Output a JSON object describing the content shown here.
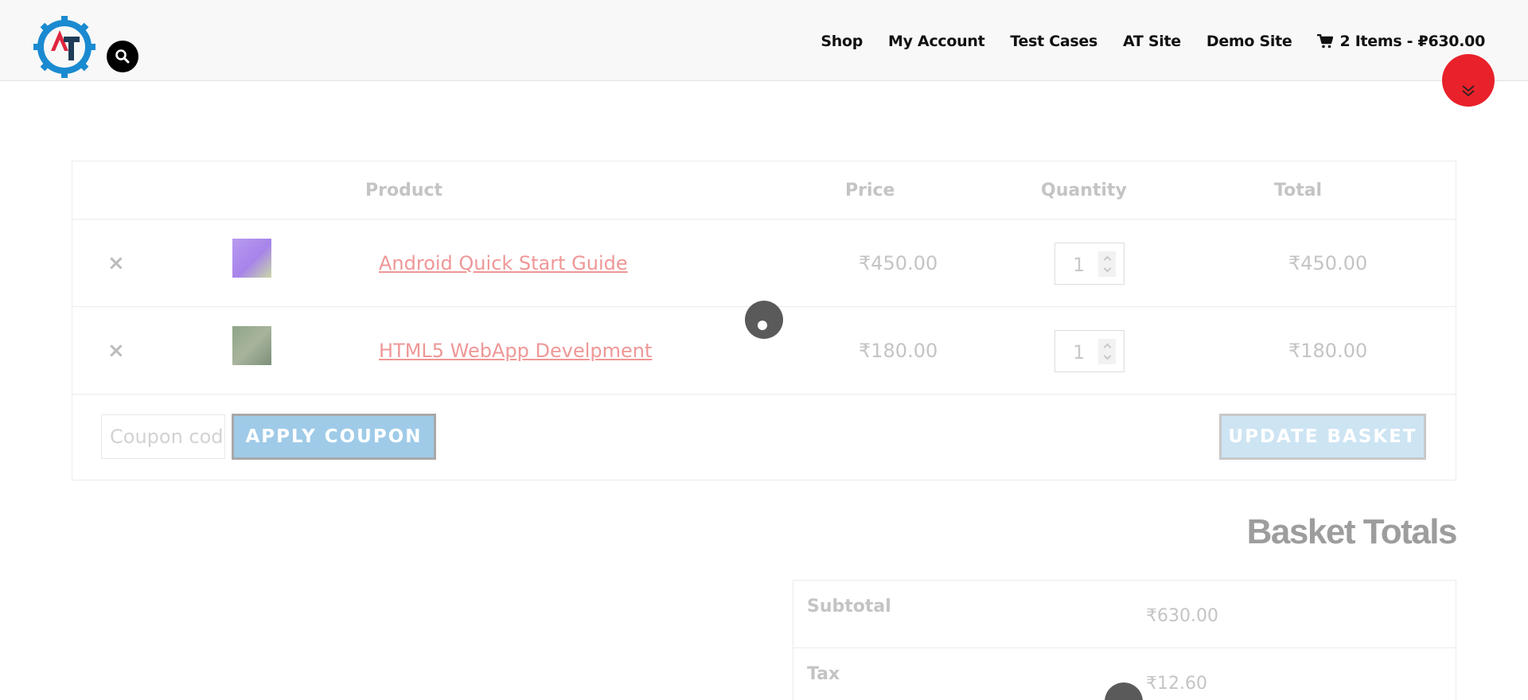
{
  "header": {
    "nav": [
      {
        "label": "Shop"
      },
      {
        "label": "My Account"
      },
      {
        "label": "Test Cases"
      },
      {
        "label": "AT Site"
      },
      {
        "label": "Demo Site"
      }
    ],
    "cart_label": "2 Items - ₽630.00"
  },
  "basket": {
    "headers": {
      "product": "Product",
      "price": "Price",
      "quantity": "Quantity",
      "total": "Total"
    },
    "items": [
      {
        "remove": "×",
        "name": "Android Quick Start Guide",
        "price": "₹450.00",
        "quantity": "1",
        "total": "₹450.00"
      },
      {
        "remove": "×",
        "name": "HTML5 WebApp Develpment",
        "price": "₹180.00",
        "quantity": "1",
        "total": "₹180.00"
      }
    ],
    "coupon_placeholder": "Coupon code",
    "apply_label": "APPLY COUPON",
    "update_label": "UPDATE BASKET"
  },
  "totals": {
    "title": "Basket Totals",
    "rows": [
      {
        "label": "Subtotal",
        "value": "₹630.00"
      },
      {
        "label": "Tax",
        "value": "₹12.60"
      }
    ]
  },
  "colors": {
    "accent_red": "#e8212a",
    "logo_blue": "#1a8ad1",
    "product_link": "#ef9797",
    "button_blue": "#9fcbe8"
  },
  "icons": [
    "logo-icon",
    "search-icon",
    "cart-icon",
    "chevron-double-down-icon",
    "remove-icon",
    "loading-spinner-icon"
  ]
}
